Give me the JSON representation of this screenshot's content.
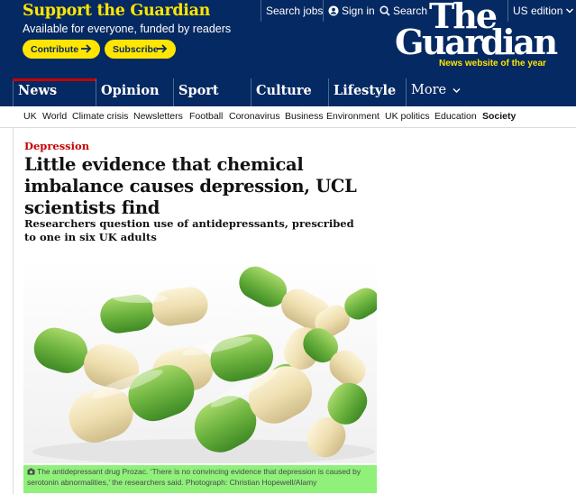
{
  "support": {
    "title": "Support the Guardian",
    "subtitle": "Available for everyone, funded by readers",
    "contribute_label": "Contribute",
    "subscribe_label": "Subscribe"
  },
  "top_links": {
    "search_jobs": "Search jobs",
    "sign_in": "Sign in",
    "search": "Search",
    "edition": "US edition"
  },
  "logo": {
    "the": "The",
    "guardian": "Guardian",
    "tagline": "News website of the year"
  },
  "pillars": [
    {
      "label": "News",
      "color": "#c70000"
    },
    {
      "label": "Opinion",
      "color": "#e05e00"
    },
    {
      "label": "Sport",
      "color": "#0084c6"
    },
    {
      "label": "Culture",
      "color": "#a1845c"
    },
    {
      "label": "Lifestyle",
      "color": "#bb3b80"
    },
    {
      "label": "More"
    }
  ],
  "subnav": [
    "UK",
    "World",
    "Climate crisis",
    "Newsletters",
    "Football",
    "Coronavirus",
    "Business",
    "Environment",
    "UK politics",
    "Education",
    "Society"
  ],
  "article": {
    "section": "Depression",
    "headline": "Little evidence that chemical imbalance causes depression, UCL scientists find",
    "standfirst": "Researchers question use of antidepressants, prescribed to one in six UK adults",
    "caption": "The antidepressant drug Prozac. ‘There is no convincing evidence that depression is caused by serotonin abnormalities,’ the researchers said. Photograph: Christian Hopewell/Alamy"
  },
  "colors": {
    "brand": "#052962",
    "accent": "#ffe500",
    "news_red": "#c70000",
    "caption_highlight": "#8ff07a"
  }
}
